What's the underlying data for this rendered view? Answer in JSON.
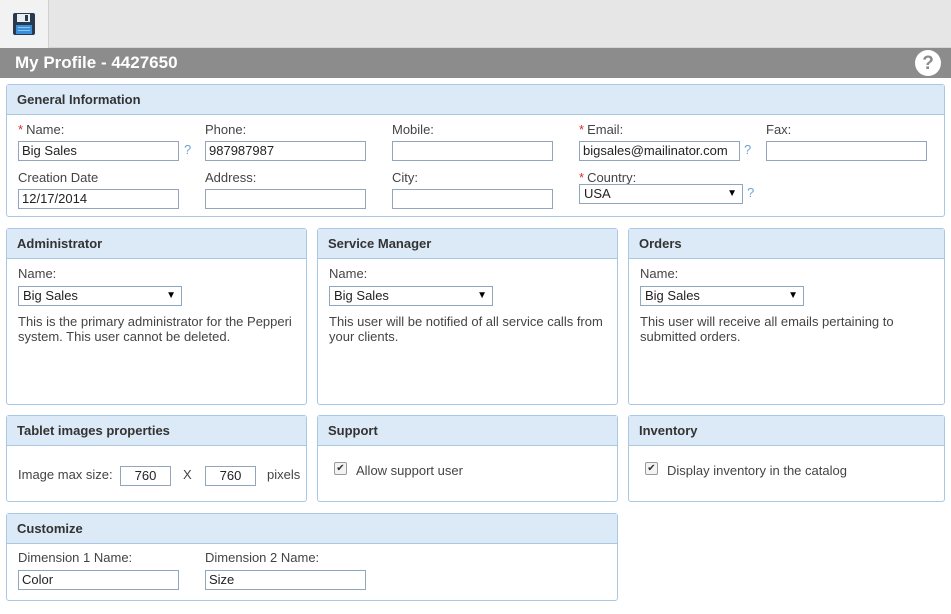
{
  "toolbar": {
    "save_icon": "floppy-disk-icon"
  },
  "header": {
    "title": "My Profile - 4427650",
    "help": "?"
  },
  "general": {
    "title": "General Information",
    "name_label": "Name:",
    "name_value": "Big Sales",
    "phone_label": "Phone:",
    "phone_value": "987987987",
    "mobile_label": "Mobile:",
    "mobile_value": "",
    "email_label": "Email:",
    "email_value": "bigsales@mailinator.com",
    "fax_label": "Fax:",
    "fax_value": "",
    "creation_label": "Creation Date",
    "creation_value": "12/17/2014",
    "address_label": "Address:",
    "address_value": "",
    "city_label": "City:",
    "city_value": "",
    "country_label": "Country:",
    "country_value": "USA",
    "required_marker": "*",
    "help_mark": "?"
  },
  "administrator": {
    "title": "Administrator",
    "name_label": "Name:",
    "selected": "Big Sales",
    "description": "This is the primary administrator for the Pepperi system. This user cannot be deleted."
  },
  "service_manager": {
    "title": "Service Manager",
    "name_label": "Name:",
    "selected": "Big Sales",
    "description": "This user will be notified of all service calls from your clients."
  },
  "orders": {
    "title": "Orders",
    "name_label": "Name:",
    "selected": "Big Sales",
    "description": "This user will receive all emails pertaining to submitted orders."
  },
  "tablet": {
    "title": "Tablet images properties",
    "max_size_label": "Image max size:",
    "width_value": "760",
    "separator": "X",
    "height_value": "760",
    "unit": "pixels"
  },
  "support": {
    "title": "Support",
    "checkbox_label": "Allow support user",
    "checked": true
  },
  "inventory": {
    "title": "Inventory",
    "checkbox_label": "Display inventory in the catalog",
    "checked": true
  },
  "customize": {
    "title": "Customize",
    "dim1_label": "Dimension 1 Name:",
    "dim1_value": "Color",
    "dim2_label": "Dimension 2 Name:",
    "dim2_value": "Size"
  },
  "glyphs": {
    "dropdown_arrow": "▼",
    "check": "✔"
  }
}
